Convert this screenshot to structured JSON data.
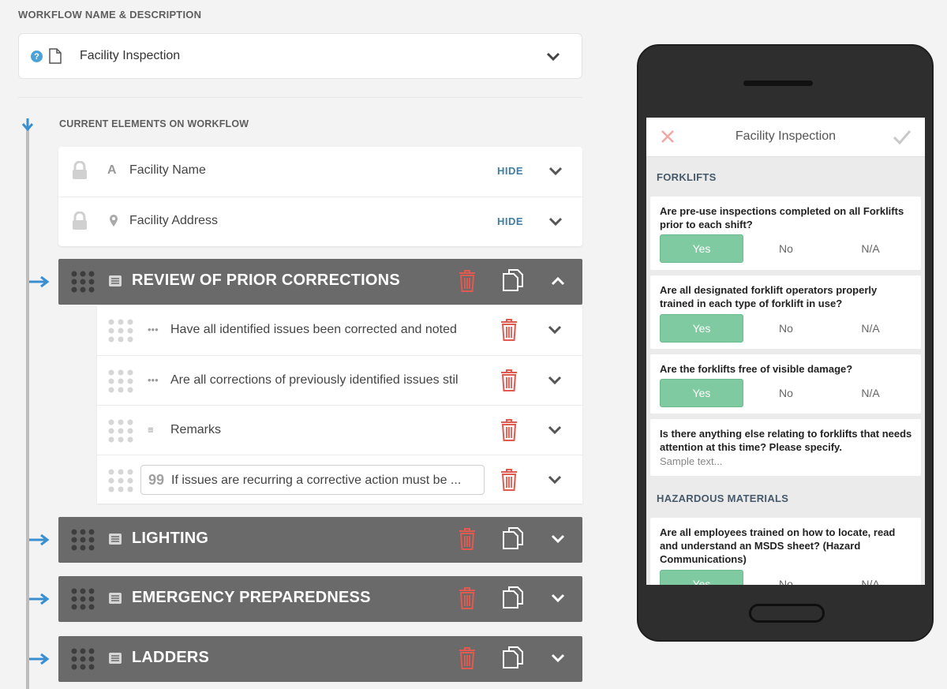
{
  "workflow": {
    "section_label": "WORKFLOW NAME & DESCRIPTION",
    "help_glyph": "?",
    "name": "Facility Inspection"
  },
  "current": {
    "label": "CURRENT ELEMENTS ON WORKFLOW",
    "static_rows": [
      {
        "type_glyph": "A",
        "label": "Facility Name",
        "action": "HIDE"
      },
      {
        "label": "Facility Address",
        "action": "HIDE"
      }
    ]
  },
  "sections": [
    {
      "title": "REVIEW OF PRIOR CORRECTIONS",
      "expanded": true
    },
    {
      "title": "LIGHTING",
      "expanded": false
    },
    {
      "title": "EMERGENCY PREPAREDNESS",
      "expanded": false
    },
    {
      "title": "LADDERS",
      "expanded": false
    }
  ],
  "review_children": [
    {
      "icon": "•••",
      "text": "Have all identified issues been corrected and noted"
    },
    {
      "icon": "•••",
      "text": "Are all corrections of previously identified issues stil"
    },
    {
      "icon": "≡",
      "text": "Remarks"
    },
    {
      "icon": "99",
      "text": "If issues are recurring a corrective action must be ..."
    }
  ],
  "phone": {
    "title": "Facility Inspection",
    "groups": [
      {
        "name": "FORKLIFTS"
      },
      {
        "name": "HAZARDOUS MATERIALS"
      }
    ],
    "questions": [
      {
        "text": "Are pre-use inspections completed on all Forklifts prior to each shift?",
        "options": [
          "Yes",
          "No",
          "N/A"
        ],
        "selected": "Yes"
      },
      {
        "text": "Are all designated forklift operators properly trained in each type of forklift in use?",
        "options": [
          "Yes",
          "No",
          "N/A"
        ],
        "selected": "Yes"
      },
      {
        "text": "Are the forklifts free of visible damage?",
        "options": [
          "Yes",
          "No",
          "N/A"
        ],
        "selected": "Yes"
      },
      {
        "text": "Is there anything else relating to forklifts that needs attention at this time? Please specify.",
        "placeholder": "Sample text..."
      },
      {
        "text": "Are all employees trained on how to locate, read and understand an MSDS sheet? (Hazard Communications)",
        "options": [
          "Yes",
          "No",
          "N/A"
        ],
        "selected": "Yes"
      }
    ]
  },
  "colors": {
    "accent_blue": "#3a8fd0",
    "hide_link": "#3c7ea6",
    "section_bg": "#6a6a6a",
    "trash_red": "#e05a4f",
    "selected_green": "#7fcaa0"
  }
}
